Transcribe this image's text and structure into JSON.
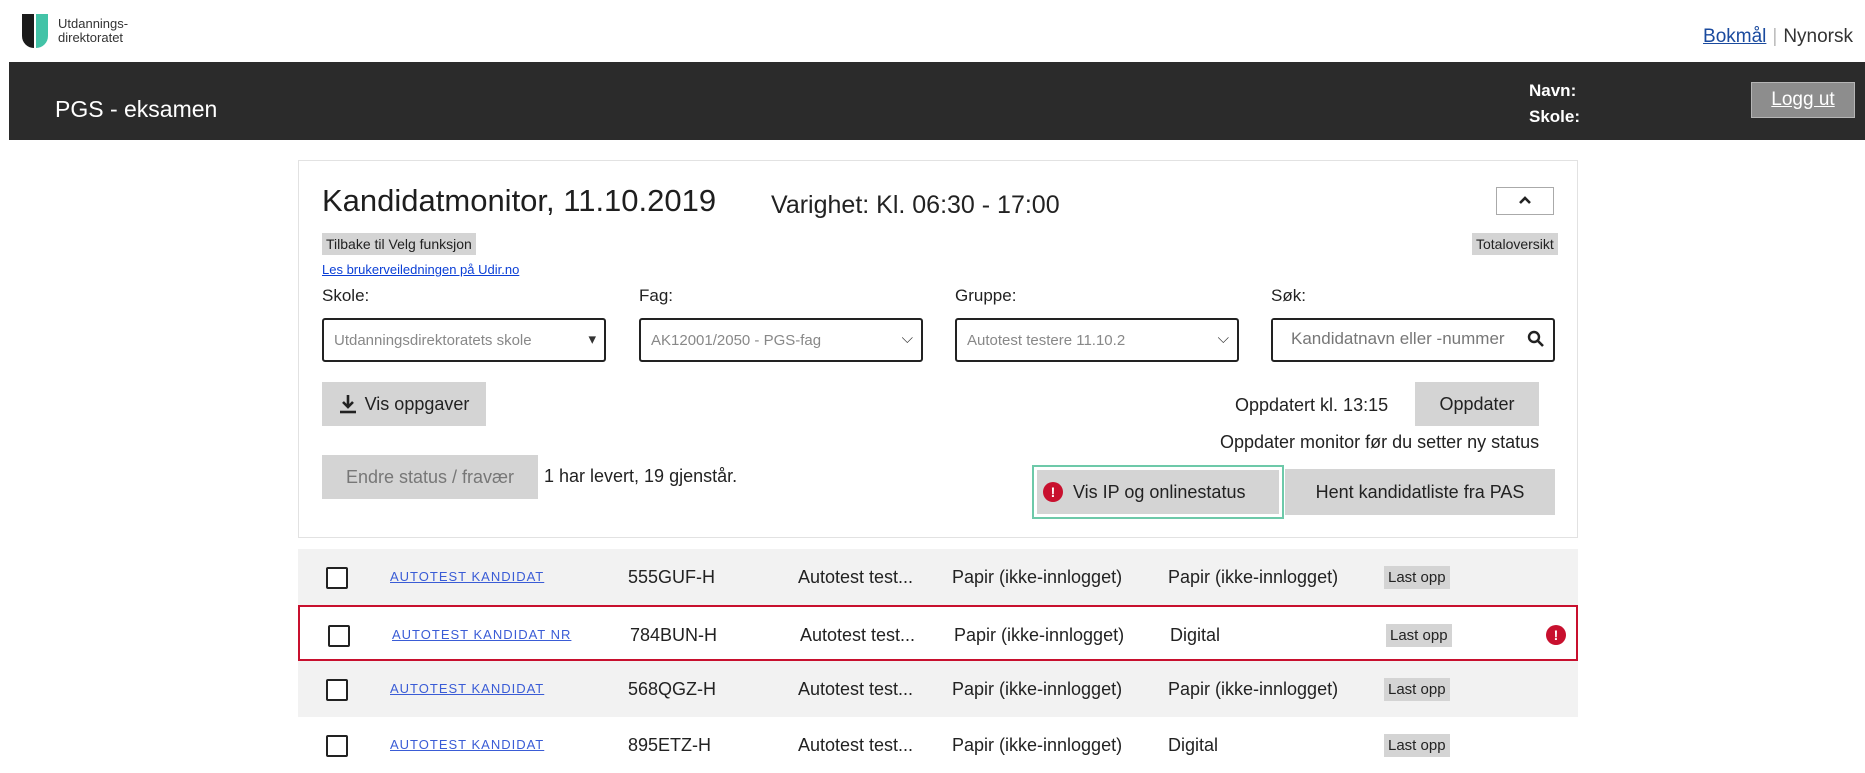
{
  "brand": {
    "line1": "Utdannings-",
    "line2": "direktoratet"
  },
  "language": {
    "bokmal": "Bokmål",
    "separator": "|",
    "nynorsk": "Nynorsk"
  },
  "header": {
    "app_title": "PGS - eksamen",
    "navn_label": "Navn:",
    "skole_label": "Skole:",
    "logout_label": "Logg ut"
  },
  "monitor": {
    "title": "Kandidatmonitor, 11.10.2019",
    "duration": "Varighet: Kl. 06:30 - 17:00",
    "collapse_icon": "chevron-up-icon",
    "back_button": "Tilbake til Velg funksjon",
    "overview_button": "Totaloversikt",
    "help_link": "Les brukerveiledningen på Udir.no"
  },
  "filters": {
    "skole": {
      "label": "Skole:",
      "value": "Utdanningsdirektoratets skole"
    },
    "fag": {
      "label": "Fag:",
      "value": "AK12001/2050 - PGS-fag"
    },
    "gruppe": {
      "label": "Gruppe:",
      "value": "Autotest testere 11.10.2"
    },
    "sok": {
      "label": "Søk:",
      "placeholder": "Kandidatnavn eller -nummer"
    }
  },
  "actions": {
    "vis_oppgaver": "Vis oppgaver",
    "updated_text": "Oppdatert kl. 13:15",
    "update_button": "Oppdater",
    "update_note": "Oppdater monitor før du setter ny status",
    "endre_status": "Endre status / fravær",
    "levert_status": "1 har levert, 19 gjenstår.",
    "vis_ip": "Vis IP og onlinestatus",
    "hent_liste": "Hent kandidatliste fra PAS"
  },
  "candidates": [
    {
      "name": "AUTOTEST KANDIDAT",
      "number": "555GUF-H",
      "group": "Autotest test...",
      "status1": "Papir (ikke-innlogget)",
      "status2": "Papir (ikke-innlogget)",
      "action": "Last opp",
      "alert": false
    },
    {
      "name": "AUTOTEST KANDIDAT NR",
      "number": "784BUN-H",
      "group": "Autotest test...",
      "status1": "Papir (ikke-innlogget)",
      "status2": "Digital",
      "action": "Last opp",
      "alert": true
    },
    {
      "name": "AUTOTEST KANDIDAT",
      "number": "568QGZ-H",
      "group": "Autotest test...",
      "status1": "Papir (ikke-innlogget)",
      "status2": "Papir (ikke-innlogget)",
      "action": "Last opp",
      "alert": false
    },
    {
      "name": "AUTOTEST KANDIDAT",
      "number": "895ETZ-H",
      "group": "Autotest test...",
      "status1": "Papir (ikke-innlogget)",
      "status2": "Digital",
      "action": "Last opp",
      "alert": false
    }
  ],
  "colors": {
    "accent": "#43c3a7",
    "alert": "#c8102e",
    "header_bg": "#2b2b2b"
  }
}
